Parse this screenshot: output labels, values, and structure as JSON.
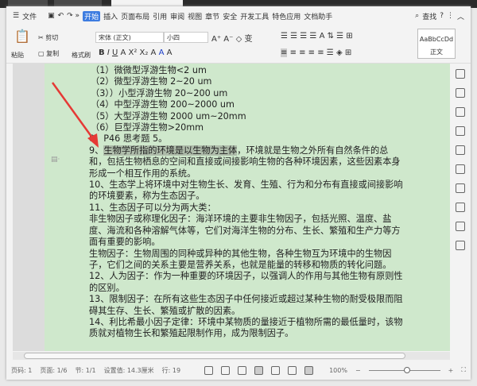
{
  "menu": {
    "file": "文件",
    "items": [
      "开始",
      "插入",
      "页面布局",
      "引用",
      "审阅",
      "视图",
      "章节",
      "安全",
      "开发工具",
      "特色应用",
      "文档助手"
    ],
    "search": "查找"
  },
  "ribbon": {
    "paste": "粘贴",
    "cut": "剪切",
    "copy": "复制",
    "format_painter": "格式刷",
    "font": "宋体 (正文)",
    "size": "小四",
    "style_preview": "AaBbCcDd",
    "style_name": "正文"
  },
  "document": {
    "lines": [
      "（1）微微型浮游生物<2 um",
      "（2）微型浮游生物 2~20 um",
      "（3））小型浮游生物 20~200 um",
      "（4）中型浮游生物 200~2000 um",
      "（5）大型浮游生物 2000 um~20mm",
      "（6）巨型浮游生物>20mm",
      "8、P46 思考题 5。"
    ],
    "p9_highlight": "生物学所指的环境是以生物为主体",
    "p9_rest": "，环境就是生物之外所有自然条件的总和，包括生物栖息的空间和直接或间接影响生物的各种环境因素，这些因素本身形成一个相互作用的系统。",
    "paras": [
      "10、生态学上将环境中对生物生长、发育、生殖、行为和分布有直接或间接影响的环境要素，称为生态因子。",
      "11、生态因子可以分为两大类：",
      "非生物因子或称理化因子：海洋环境的主要非生物因子，包括光照、温度、盐度、海流和各种溶解气体等，它们对海洋生物的分布、生长、繁殖和生产力等方面有重要的影响。",
      "生物因子：生物周围的同种或异种的其他生物，各种生物互为环境中的生物因子，它们之间的关系主要是营养关系，也就是能量的转移和物质的转化问题。",
      "12、人为因子：作为一种重要的环境因子，以强调人的作用与其他生物有原则性的区别。",
      "13、限制因子：在所有这些生态因子中任何接近或超过某种生物的耐受极限而阻碍其生存、生长、繁殖或扩散的因素。",
      "14、利比希最小因子定律：环境中某物质的量接近于植物所需的最低量时，该物质就对植物生长和繁殖起限制作用，成为限制因子。"
    ]
  },
  "status": {
    "page": "页码: 1",
    "pages": "页面: 1/6",
    "section": "节: 1/1",
    "setting": "设置值: 14.3厘米",
    "row": "行: 19",
    "zoom": "100%"
  },
  "colors": {
    "page_bg": "#cfe8cc",
    "accent": "#3d7ce0",
    "arrow": "#e53935"
  }
}
